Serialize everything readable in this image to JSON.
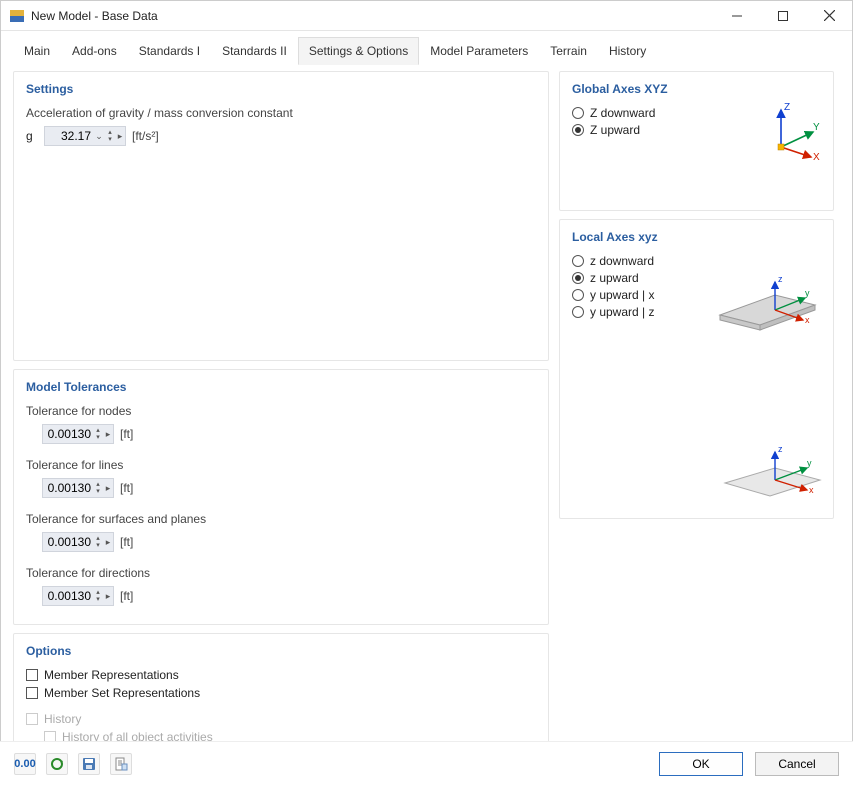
{
  "window": {
    "title": "New Model - Base Data"
  },
  "tabs": [
    "Main",
    "Add-ons",
    "Standards I",
    "Standards II",
    "Settings & Options",
    "Model Parameters",
    "Terrain",
    "History"
  ],
  "active_tab_index": 4,
  "settings": {
    "title": "Settings",
    "gravity_label": "Acceleration of gravity / mass conversion constant",
    "g_symbol": "g",
    "g_value": "32.17",
    "g_unit": "[ft/s²]"
  },
  "tolerances": {
    "title": "Model Tolerances",
    "items": [
      {
        "label": "Tolerance for nodes",
        "value": "0.00130",
        "unit": "[ft]"
      },
      {
        "label": "Tolerance for lines",
        "value": "0.00130",
        "unit": "[ft]"
      },
      {
        "label": "Tolerance for surfaces and planes",
        "value": "0.00130",
        "unit": "[ft]"
      },
      {
        "label": "Tolerance for directions",
        "value": "0.00130",
        "unit": "[ft]"
      }
    ]
  },
  "options": {
    "title": "Options",
    "member_rep": "Member Representations",
    "memberset_rep": "Member Set Representations",
    "history": "History",
    "history_sub": "History of all object activities"
  },
  "global_axes": {
    "title": "Global Axes XYZ",
    "z_down": "Z downward",
    "z_up": "Z upward",
    "selected": "z_up"
  },
  "local_axes": {
    "title": "Local Axes xyz",
    "items": [
      {
        "key": "z_down",
        "label": "z downward"
      },
      {
        "key": "z_up",
        "label": "z upward"
      },
      {
        "key": "y_up_x",
        "label": "y upward | x"
      },
      {
        "key": "y_up_z",
        "label": "y upward | z"
      }
    ],
    "selected": "z_up"
  },
  "footer": {
    "ok": "OK",
    "cancel": "Cancel"
  }
}
